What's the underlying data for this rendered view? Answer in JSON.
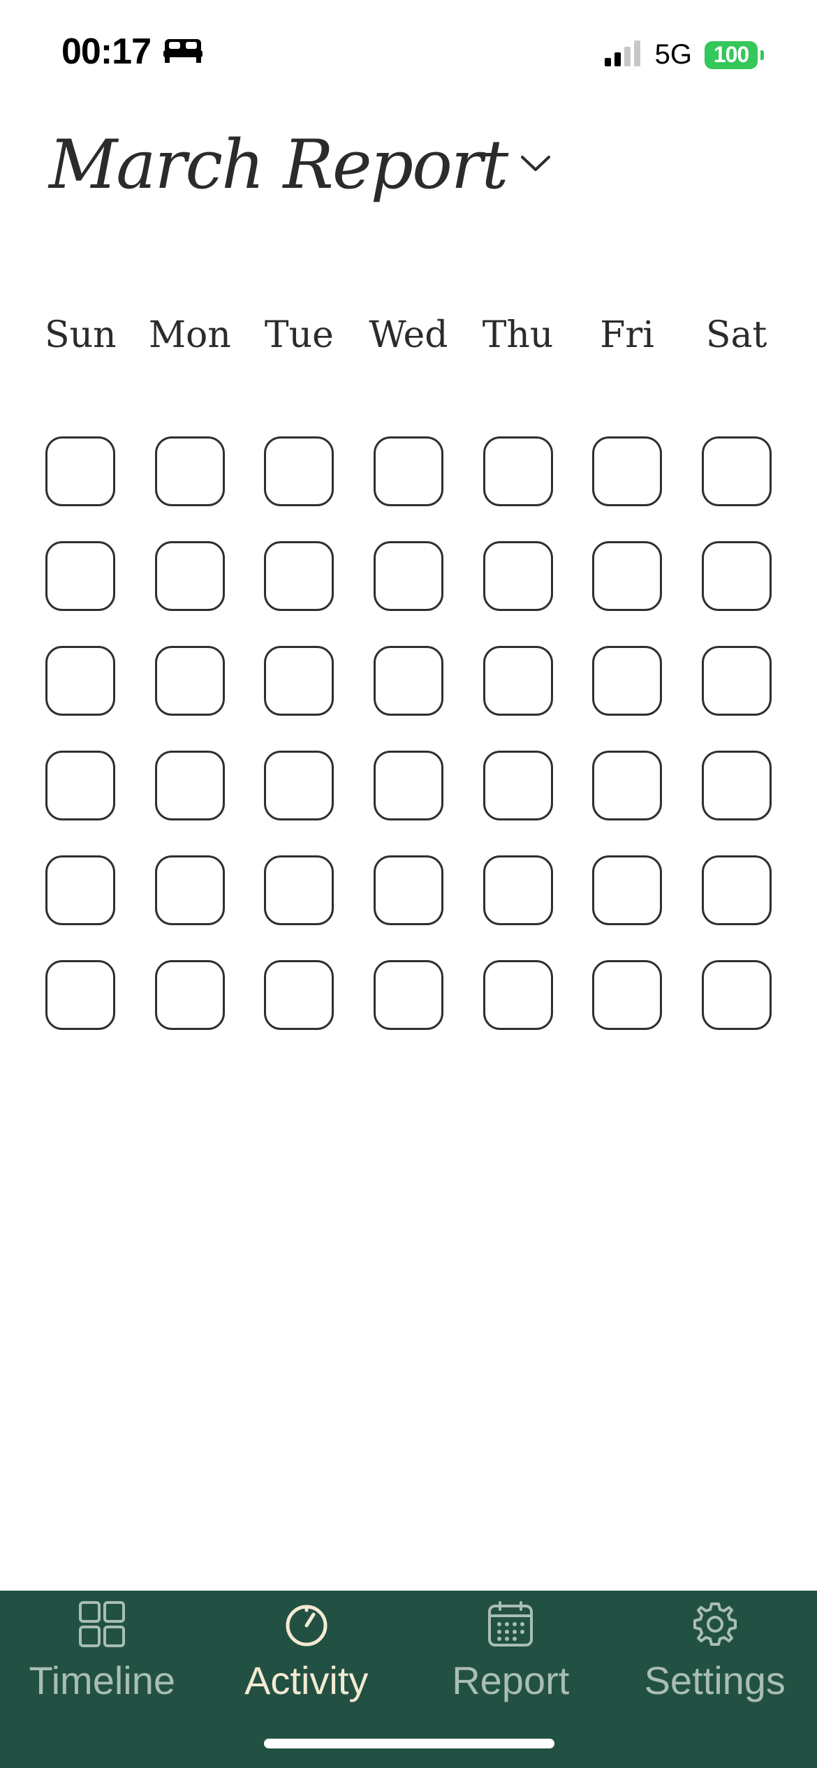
{
  "status_bar": {
    "time": "00:17",
    "network": "5G",
    "battery": "100",
    "icons": [
      "bed-icon",
      "signal-icon",
      "battery-icon"
    ]
  },
  "header": {
    "title": "March Report",
    "icon": "chevron-down-icon"
  },
  "calendar": {
    "weekdays": [
      "Sun",
      "Mon",
      "Tue",
      "Wed",
      "Thu",
      "Fri",
      "Sat"
    ],
    "rows": 6,
    "columns": 7
  },
  "tab_bar": {
    "tabs": [
      {
        "label": "Timeline",
        "icon": "grid-icon",
        "active": false
      },
      {
        "label": "Activity",
        "icon": "timer-icon",
        "active": true
      },
      {
        "label": "Report",
        "icon": "calendar-icon",
        "active": false
      },
      {
        "label": "Settings",
        "icon": "gear-icon",
        "active": false
      }
    ]
  },
  "colors": {
    "tab_bar_bg": "#225143",
    "tab_active": "#f4ead2",
    "tab_inactive": "#a9bdb6",
    "battery": "#34c759",
    "box_border": "#2f2f2f"
  }
}
